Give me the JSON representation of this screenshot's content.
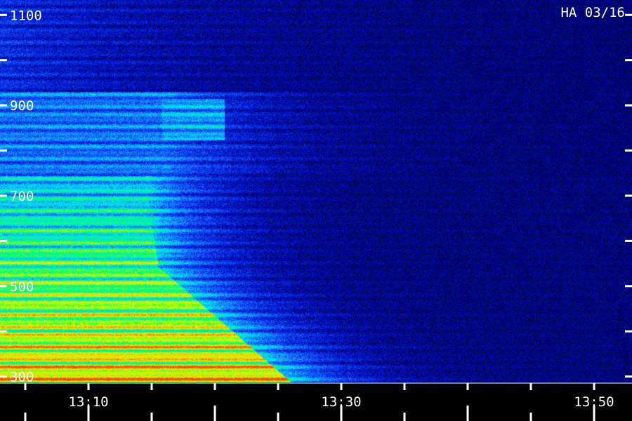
{
  "chart_data": {
    "type": "heatmap",
    "title": "HA 03/16",
    "xlabel": "",
    "ylabel": "",
    "y_ticks": [
      300,
      500,
      700,
      900,
      1100
    ],
    "y_minor_ticks": [
      400,
      600,
      800,
      1000
    ],
    "x_ticks": [
      "13:10",
      "13:30",
      "13:50"
    ],
    "x_tick_values_min": [
      10,
      30,
      50
    ],
    "x_range_min": [
      3,
      53
    ],
    "y_range": [
      287,
      1133
    ],
    "colormap": [
      "#00003a",
      "#0010d0",
      "#1a60ff",
      "#00e0ff",
      "#00ff66",
      "#c8ff00",
      "#ffcc00",
      "#ff4000"
    ],
    "grid": false
  },
  "colors": {
    "background": "#000000",
    "axis": "#ffffff"
  }
}
